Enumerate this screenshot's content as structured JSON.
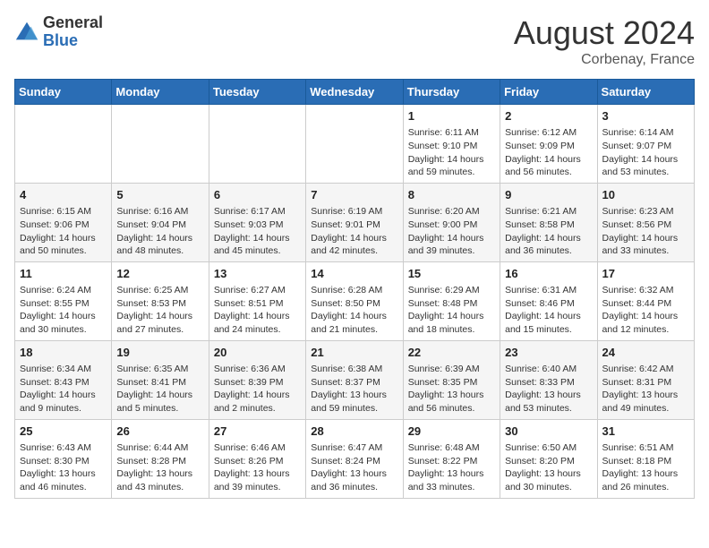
{
  "header": {
    "logo_general": "General",
    "logo_blue": "Blue",
    "month_title": "August 2024",
    "location": "Corbenay, France"
  },
  "weekdays": [
    "Sunday",
    "Monday",
    "Tuesday",
    "Wednesday",
    "Thursday",
    "Friday",
    "Saturday"
  ],
  "weeks": [
    [
      {
        "day": "",
        "info": ""
      },
      {
        "day": "",
        "info": ""
      },
      {
        "day": "",
        "info": ""
      },
      {
        "day": "",
        "info": ""
      },
      {
        "day": "1",
        "info": "Sunrise: 6:11 AM\nSunset: 9:10 PM\nDaylight: 14 hours\nand 59 minutes."
      },
      {
        "day": "2",
        "info": "Sunrise: 6:12 AM\nSunset: 9:09 PM\nDaylight: 14 hours\nand 56 minutes."
      },
      {
        "day": "3",
        "info": "Sunrise: 6:14 AM\nSunset: 9:07 PM\nDaylight: 14 hours\nand 53 minutes."
      }
    ],
    [
      {
        "day": "4",
        "info": "Sunrise: 6:15 AM\nSunset: 9:06 PM\nDaylight: 14 hours\nand 50 minutes."
      },
      {
        "day": "5",
        "info": "Sunrise: 6:16 AM\nSunset: 9:04 PM\nDaylight: 14 hours\nand 48 minutes."
      },
      {
        "day": "6",
        "info": "Sunrise: 6:17 AM\nSunset: 9:03 PM\nDaylight: 14 hours\nand 45 minutes."
      },
      {
        "day": "7",
        "info": "Sunrise: 6:19 AM\nSunset: 9:01 PM\nDaylight: 14 hours\nand 42 minutes."
      },
      {
        "day": "8",
        "info": "Sunrise: 6:20 AM\nSunset: 9:00 PM\nDaylight: 14 hours\nand 39 minutes."
      },
      {
        "day": "9",
        "info": "Sunrise: 6:21 AM\nSunset: 8:58 PM\nDaylight: 14 hours\nand 36 minutes."
      },
      {
        "day": "10",
        "info": "Sunrise: 6:23 AM\nSunset: 8:56 PM\nDaylight: 14 hours\nand 33 minutes."
      }
    ],
    [
      {
        "day": "11",
        "info": "Sunrise: 6:24 AM\nSunset: 8:55 PM\nDaylight: 14 hours\nand 30 minutes."
      },
      {
        "day": "12",
        "info": "Sunrise: 6:25 AM\nSunset: 8:53 PM\nDaylight: 14 hours\nand 27 minutes."
      },
      {
        "day": "13",
        "info": "Sunrise: 6:27 AM\nSunset: 8:51 PM\nDaylight: 14 hours\nand 24 minutes."
      },
      {
        "day": "14",
        "info": "Sunrise: 6:28 AM\nSunset: 8:50 PM\nDaylight: 14 hours\nand 21 minutes."
      },
      {
        "day": "15",
        "info": "Sunrise: 6:29 AM\nSunset: 8:48 PM\nDaylight: 14 hours\nand 18 minutes."
      },
      {
        "day": "16",
        "info": "Sunrise: 6:31 AM\nSunset: 8:46 PM\nDaylight: 14 hours\nand 15 minutes."
      },
      {
        "day": "17",
        "info": "Sunrise: 6:32 AM\nSunset: 8:44 PM\nDaylight: 14 hours\nand 12 minutes."
      }
    ],
    [
      {
        "day": "18",
        "info": "Sunrise: 6:34 AM\nSunset: 8:43 PM\nDaylight: 14 hours\nand 9 minutes."
      },
      {
        "day": "19",
        "info": "Sunrise: 6:35 AM\nSunset: 8:41 PM\nDaylight: 14 hours\nand 5 minutes."
      },
      {
        "day": "20",
        "info": "Sunrise: 6:36 AM\nSunset: 8:39 PM\nDaylight: 14 hours\nand 2 minutes."
      },
      {
        "day": "21",
        "info": "Sunrise: 6:38 AM\nSunset: 8:37 PM\nDaylight: 13 hours\nand 59 minutes."
      },
      {
        "day": "22",
        "info": "Sunrise: 6:39 AM\nSunset: 8:35 PM\nDaylight: 13 hours\nand 56 minutes."
      },
      {
        "day": "23",
        "info": "Sunrise: 6:40 AM\nSunset: 8:33 PM\nDaylight: 13 hours\nand 53 minutes."
      },
      {
        "day": "24",
        "info": "Sunrise: 6:42 AM\nSunset: 8:31 PM\nDaylight: 13 hours\nand 49 minutes."
      }
    ],
    [
      {
        "day": "25",
        "info": "Sunrise: 6:43 AM\nSunset: 8:30 PM\nDaylight: 13 hours\nand 46 minutes."
      },
      {
        "day": "26",
        "info": "Sunrise: 6:44 AM\nSunset: 8:28 PM\nDaylight: 13 hours\nand 43 minutes."
      },
      {
        "day": "27",
        "info": "Sunrise: 6:46 AM\nSunset: 8:26 PM\nDaylight: 13 hours\nand 39 minutes."
      },
      {
        "day": "28",
        "info": "Sunrise: 6:47 AM\nSunset: 8:24 PM\nDaylight: 13 hours\nand 36 minutes."
      },
      {
        "day": "29",
        "info": "Sunrise: 6:48 AM\nSunset: 8:22 PM\nDaylight: 13 hours\nand 33 minutes."
      },
      {
        "day": "30",
        "info": "Sunrise: 6:50 AM\nSunset: 8:20 PM\nDaylight: 13 hours\nand 30 minutes."
      },
      {
        "day": "31",
        "info": "Sunrise: 6:51 AM\nSunset: 8:18 PM\nDaylight: 13 hours\nand 26 minutes."
      }
    ]
  ]
}
